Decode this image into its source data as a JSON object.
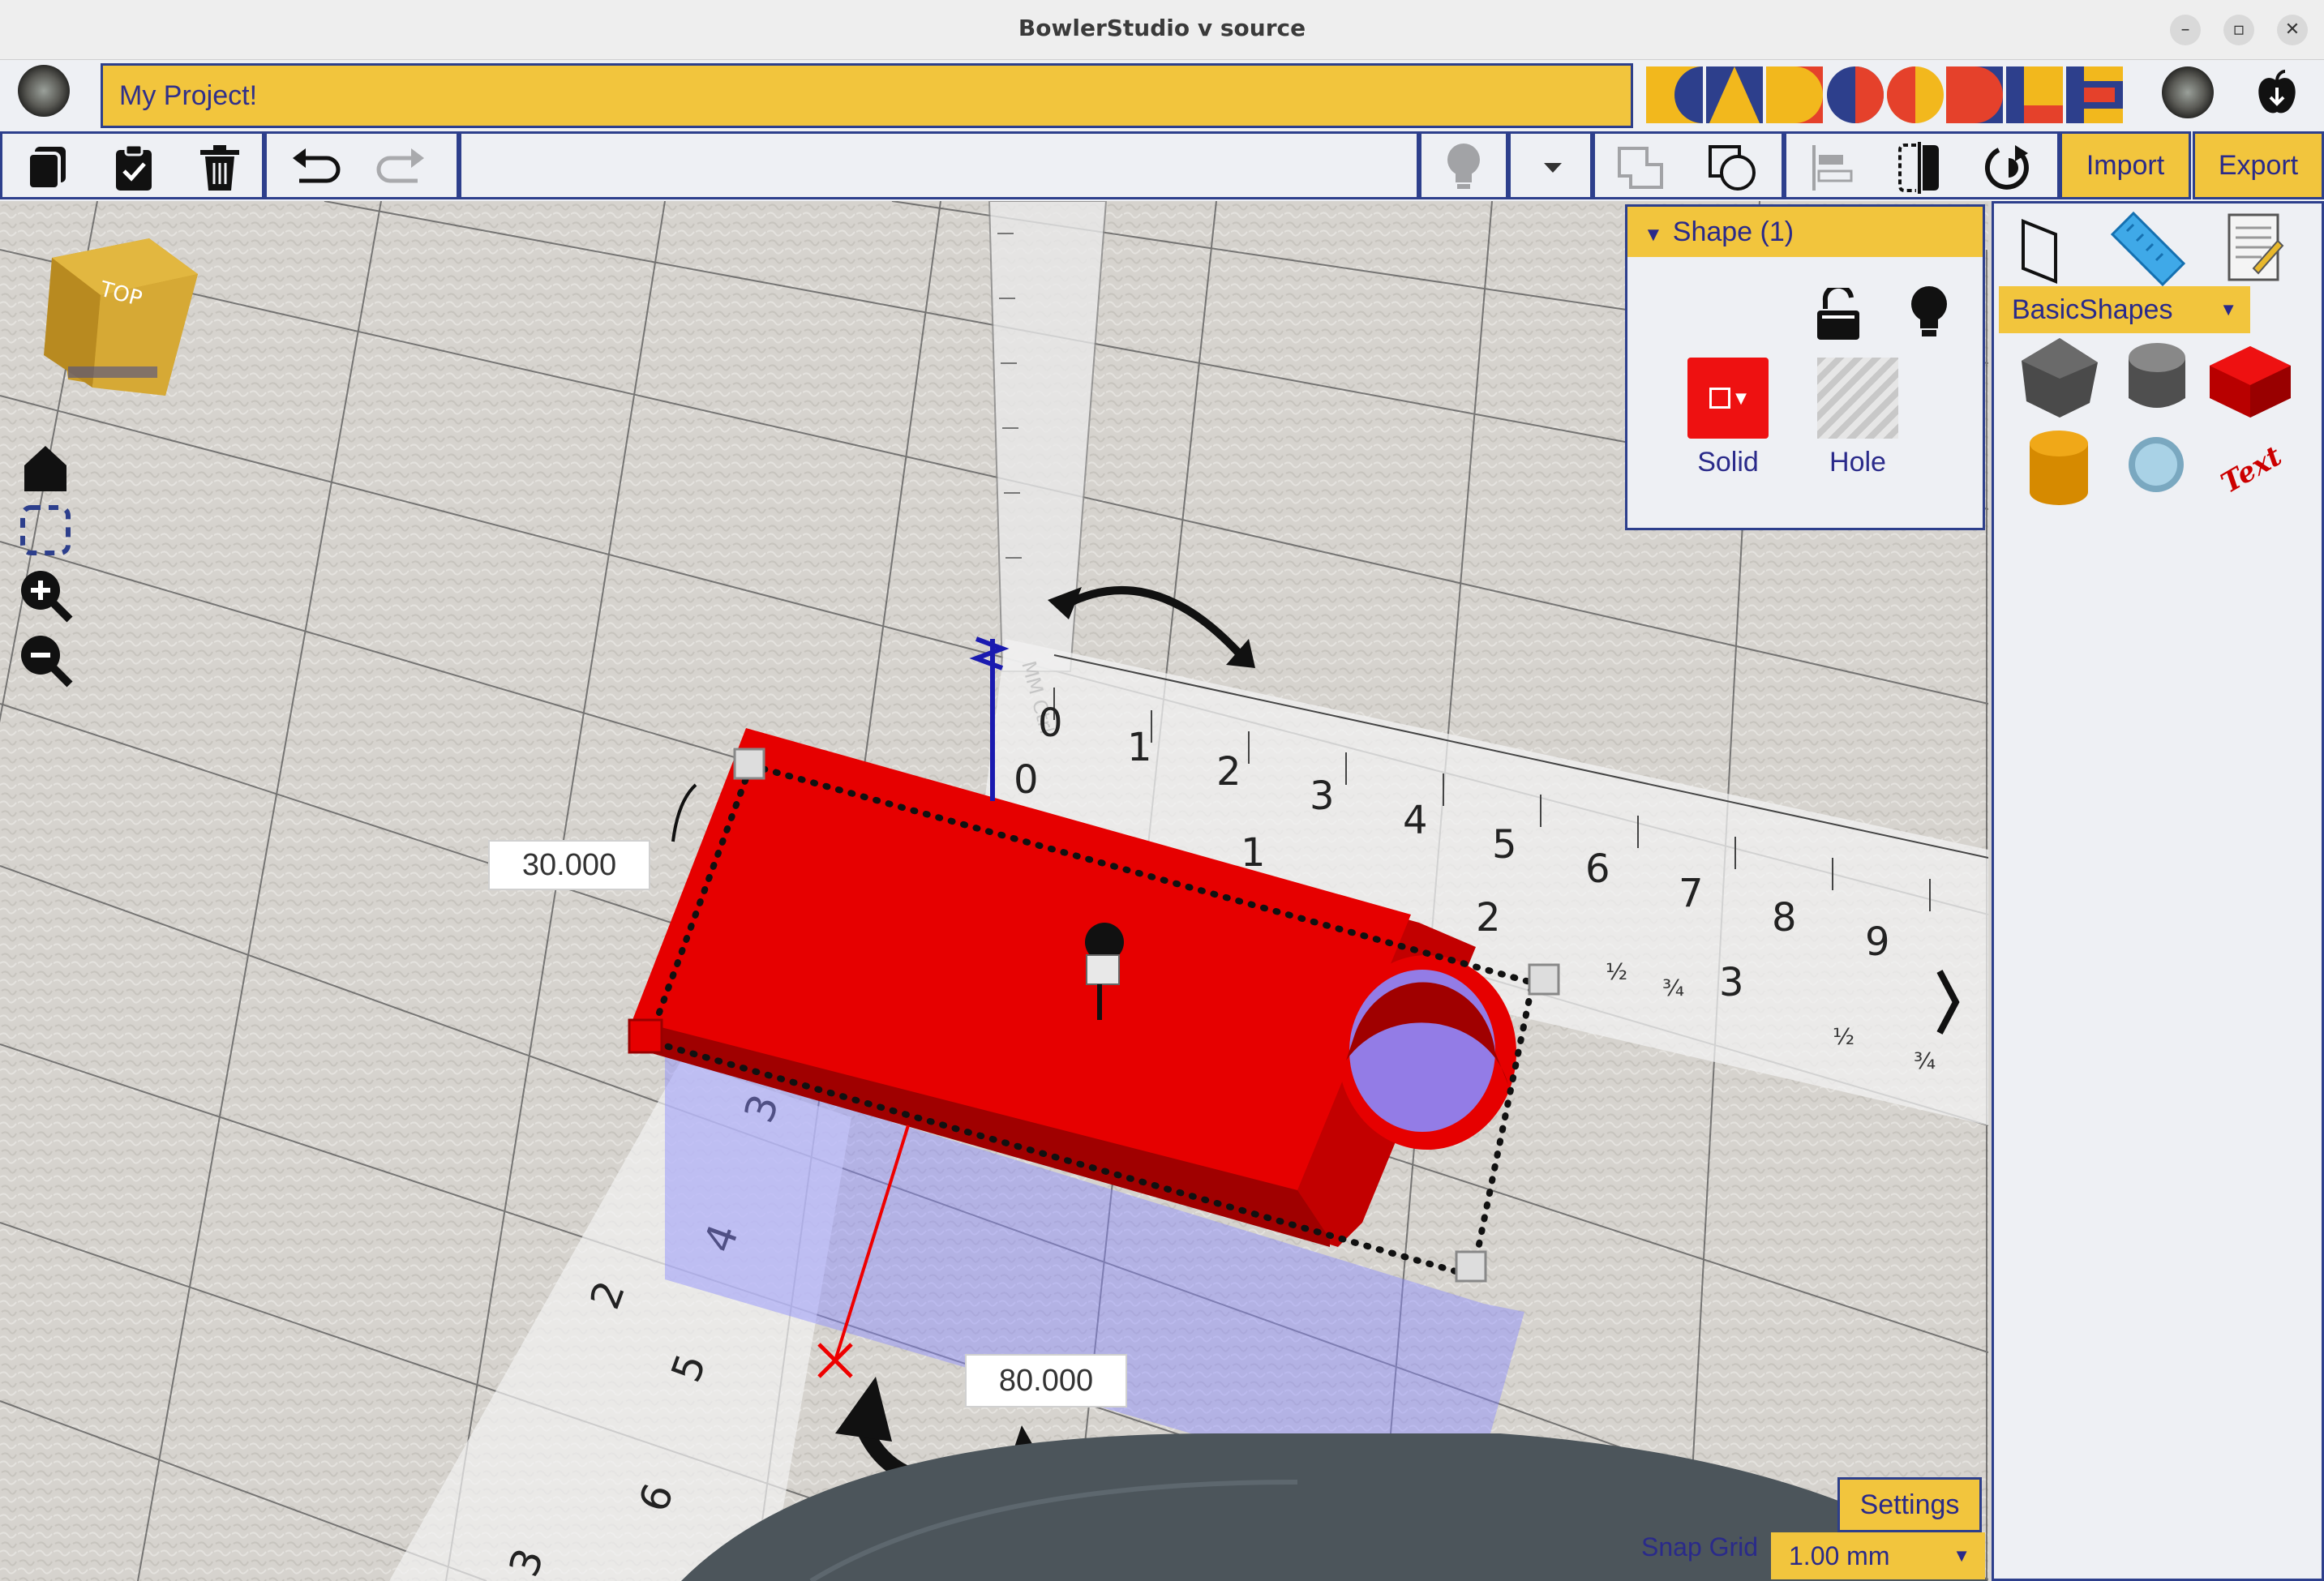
{
  "window": {
    "title": "BowlerStudio v source"
  },
  "project": {
    "name": "My Project!"
  },
  "toolbar": {
    "copy_icon": "copy-icon",
    "paste_icon": "clipboard-check-icon",
    "delete_icon": "trash-icon",
    "undo_icon": "undo-icon",
    "redo_icon": "redo-icon",
    "import_label": "Import",
    "export_label": "Export"
  },
  "shape_panel": {
    "header": "Shape (1)",
    "solid_label": "Solid",
    "hole_label": "Hole",
    "solid_color": "#ee1111"
  },
  "library": {
    "category": "BasicShapes"
  },
  "viewport": {
    "cube_label": "TOP",
    "dim_width": "30.000",
    "dim_length": "80.000"
  },
  "footer": {
    "settings_label": "Settings",
    "snap_label": "Snap Grid",
    "snap_value": "1.00 mm"
  },
  "colors": {
    "accent": "#f2c53d",
    "border": "#2d3f8c",
    "object": "#e60000"
  }
}
